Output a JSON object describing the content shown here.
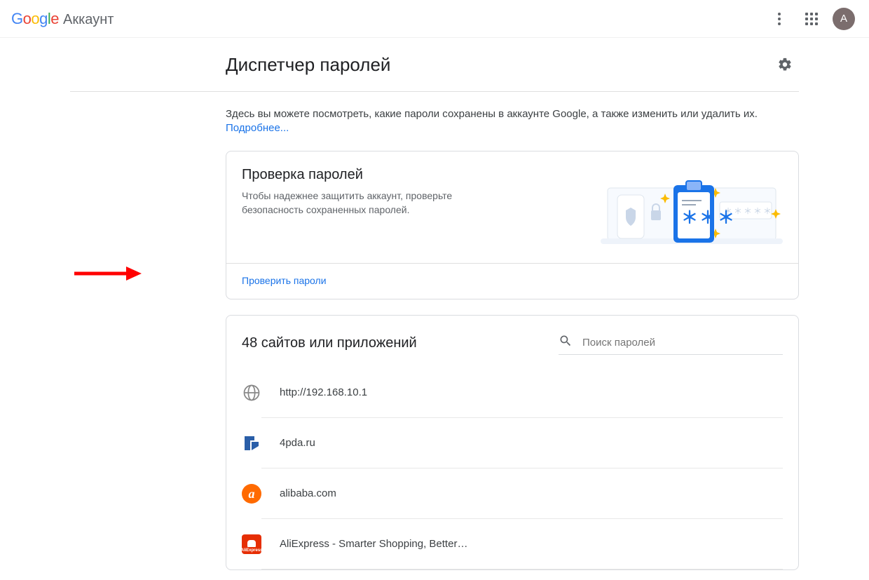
{
  "topbar": {
    "google": "Google",
    "account_label": "Аккаунт",
    "avatar_letter": "А"
  },
  "header": {
    "title": "Диспетчер паролей"
  },
  "intro": {
    "text": "Здесь вы можете посмотреть, какие пароли сохранены в аккаунте Google, а также изменить или удалить их.",
    "more": "Подробнее..."
  },
  "checkup": {
    "title": "Проверка паролей",
    "subtitle": "Чтобы надежнее защитить аккаунт, проверьте безопасность сохраненных паролей.",
    "action": "Проверить пароли"
  },
  "sites": {
    "count": 48,
    "title": "48 сайтов или приложений",
    "search_placeholder": "Поиск паролей",
    "items": [
      {
        "label": "http://192.168.10.1",
        "icon": "globe"
      },
      {
        "label": "4pda.ru",
        "icon": "4pda"
      },
      {
        "label": "alibaba.com",
        "icon": "alibaba"
      },
      {
        "label": "AliExpress - Smarter Shopping, Better…",
        "icon": "aliexpress"
      }
    ]
  }
}
